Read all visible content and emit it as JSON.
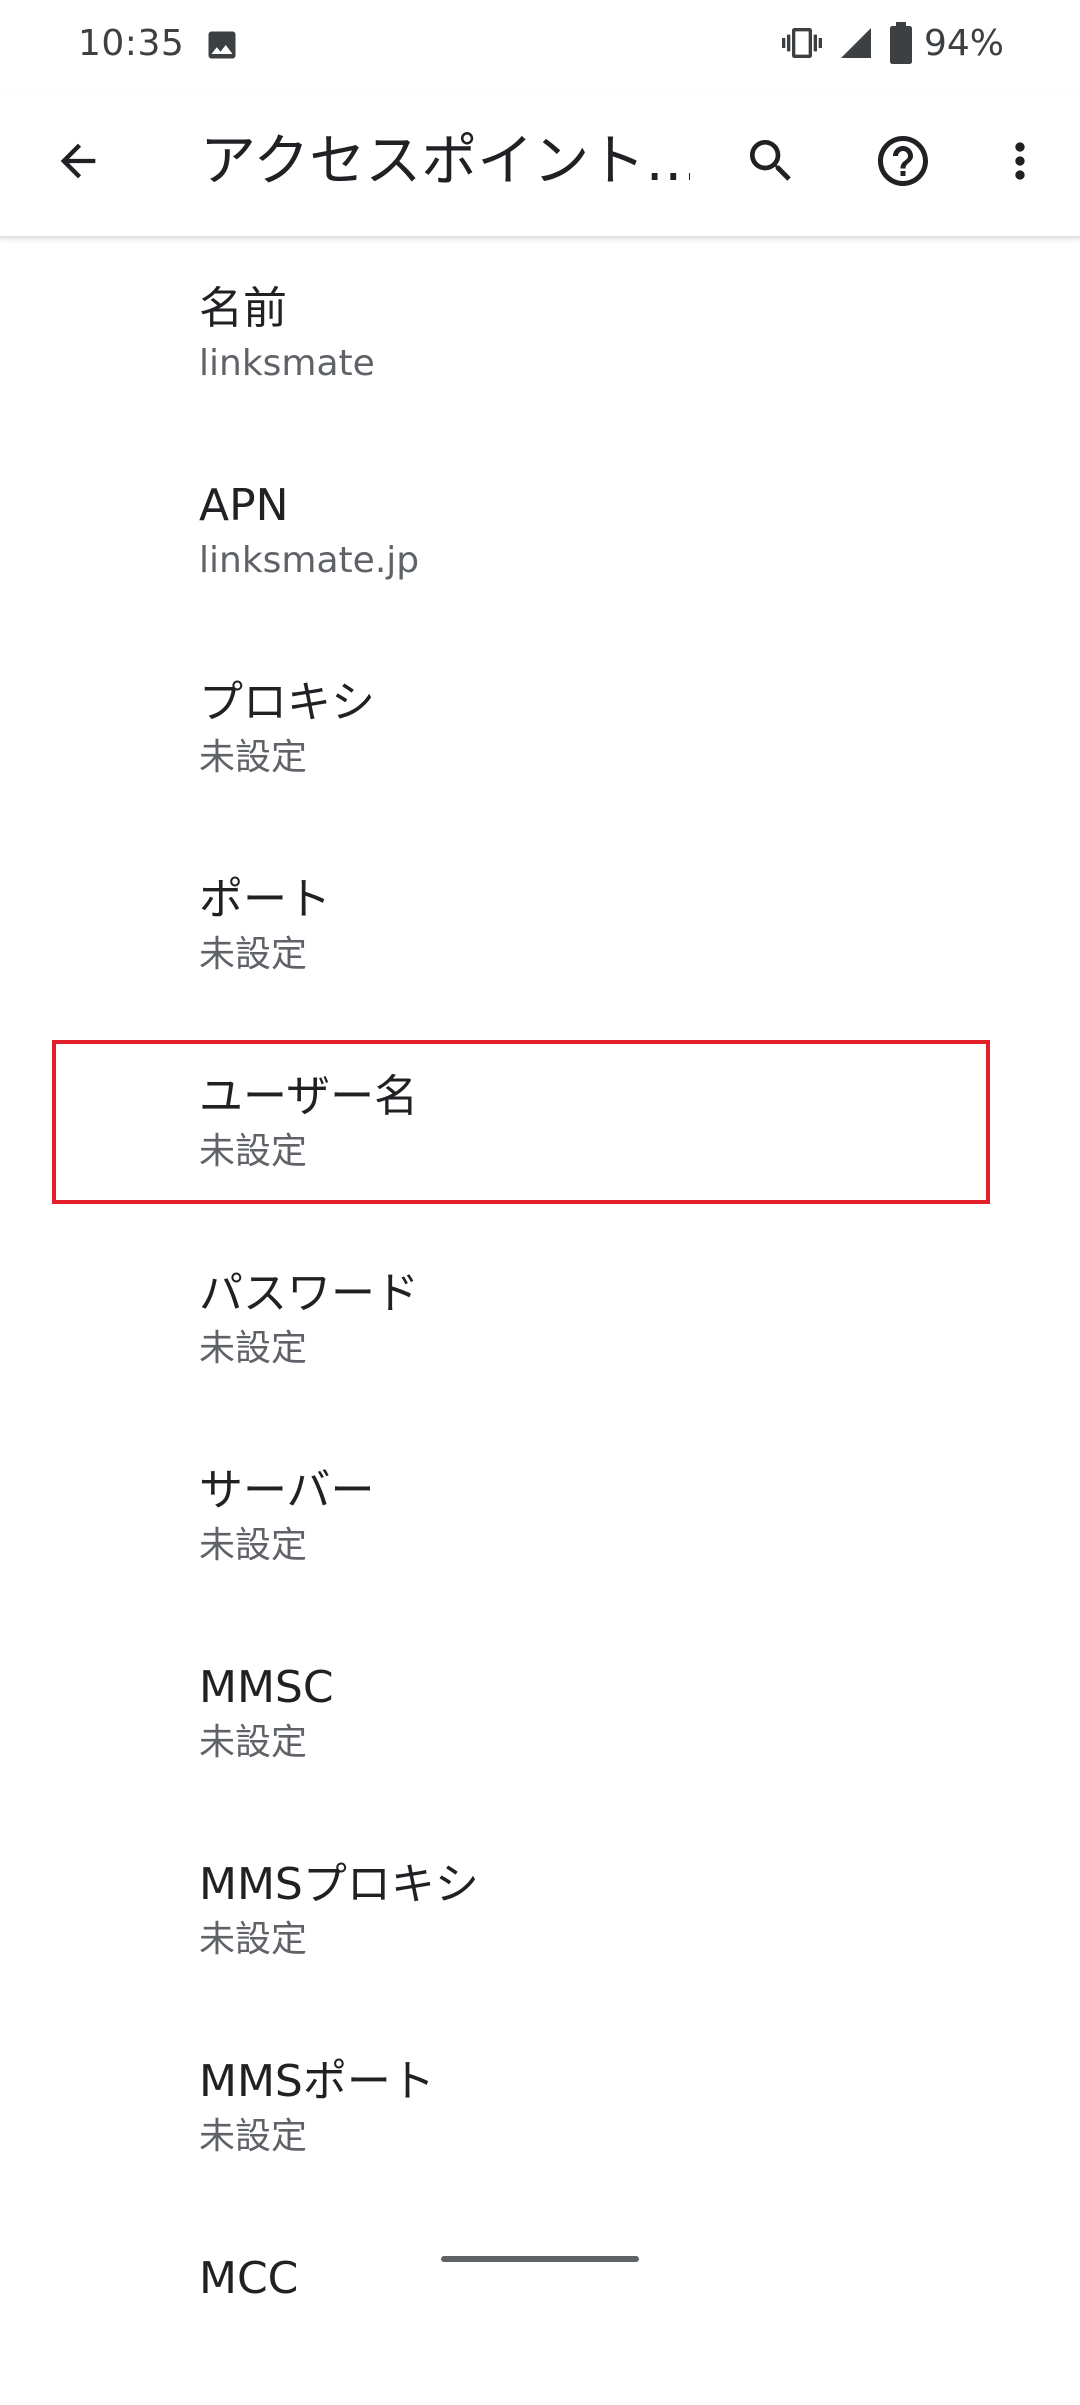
{
  "status_bar": {
    "time": "10:35",
    "battery": "94%",
    "icons": [
      "photo-icon",
      "vibrate-icon",
      "signal-icon",
      "battery-icon"
    ]
  },
  "app_bar": {
    "title": "アクセスポイント…",
    "icons": [
      "back-arrow-icon",
      "search-icon",
      "help-icon",
      "more-vert-icon"
    ]
  },
  "preferences": [
    {
      "title": "名前",
      "summary": "linksmate"
    },
    {
      "title": "APN",
      "summary": "linksmate.jp"
    },
    {
      "title": "プロキシ",
      "summary": "未設定"
    },
    {
      "title": "ポート",
      "summary": "未設定"
    },
    {
      "title": "ユーザー名",
      "summary": "未設定"
    },
    {
      "title": "パスワード",
      "summary": "未設定"
    },
    {
      "title": "サーバー",
      "summary": "未設定"
    },
    {
      "title": "MMSC",
      "summary": "未設定"
    },
    {
      "title": "MMSプロキシ",
      "summary": "未設定"
    },
    {
      "title": "MMSポート",
      "summary": "未設定"
    },
    {
      "title": "MCC",
      "summary": ""
    }
  ],
  "colors": {
    "highlight": "#e3202a",
    "text_primary": "#202124",
    "text_secondary": "#5f6368"
  }
}
